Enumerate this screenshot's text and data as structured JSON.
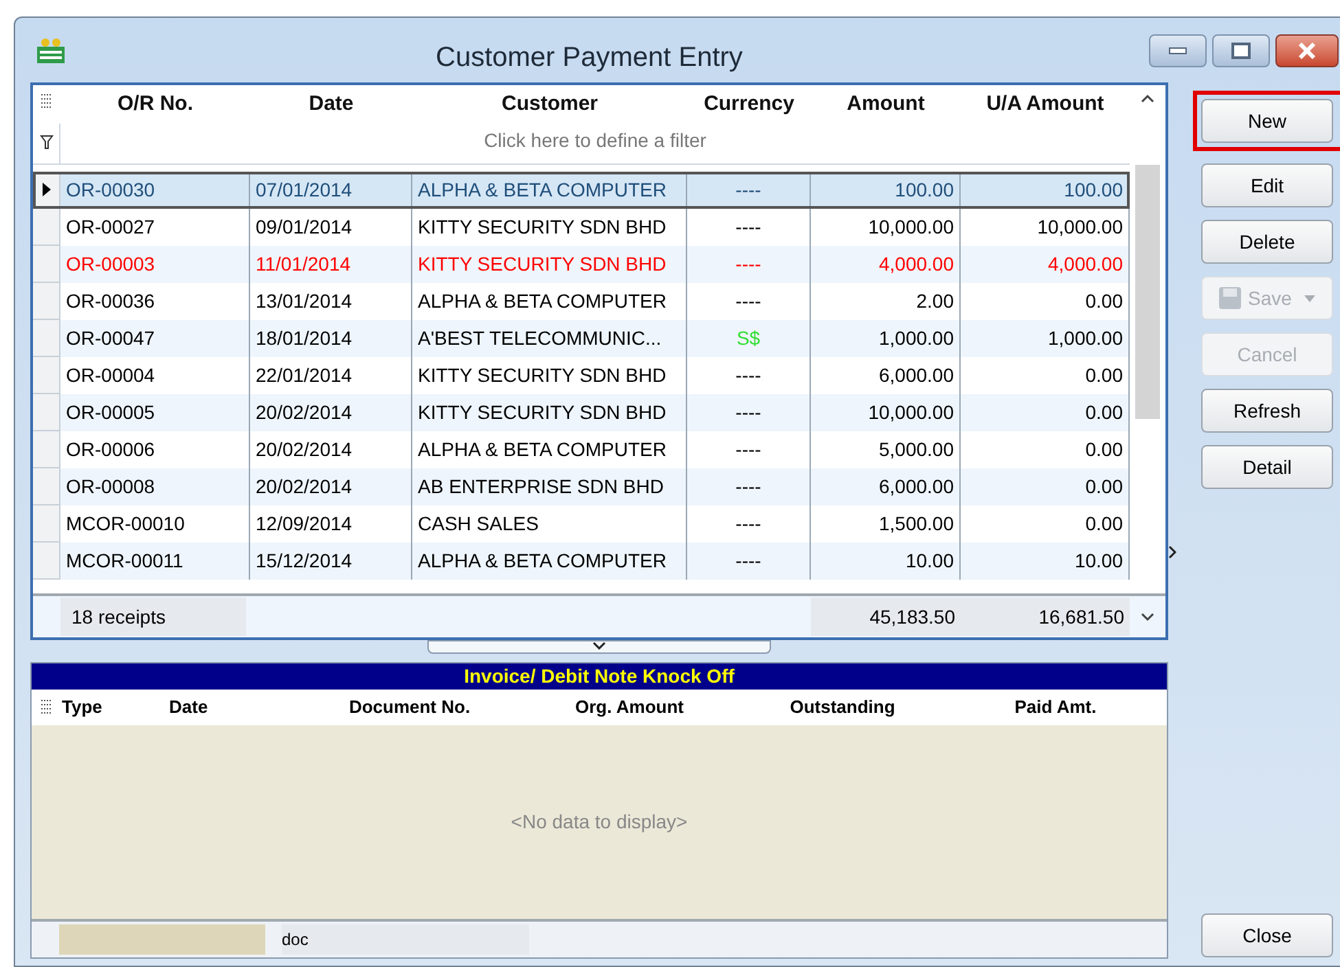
{
  "window": {
    "title": "Customer Payment Entry"
  },
  "receipts": {
    "columns": [
      "O/R No.",
      "Date",
      "Customer",
      "Currency",
      "Amount",
      "U/A Amount"
    ],
    "filter_hint": "Click here to define a filter",
    "rows": [
      {
        "selected": true,
        "color": "#1f4e79",
        "foreign_currency": false,
        "cells": [
          "OR-00030",
          "07/01/2014",
          "ALPHA & BETA COMPUTER",
          "----",
          "100.00",
          "100.00"
        ]
      },
      {
        "selected": false,
        "color": "#000000",
        "foreign_currency": false,
        "cells": [
          "OR-00027",
          "09/01/2014",
          "KITTY SECURITY SDN BHD",
          "----",
          "10,000.00",
          "10,000.00"
        ]
      },
      {
        "selected": false,
        "color": "#ff0000",
        "foreign_currency": false,
        "cells": [
          "OR-00003",
          "11/01/2014",
          "KITTY SECURITY SDN BHD",
          "----",
          "4,000.00",
          "4,000.00"
        ]
      },
      {
        "selected": false,
        "color": "#000000",
        "foreign_currency": false,
        "cells": [
          "OR-00036",
          "13/01/2014",
          "ALPHA & BETA COMPUTER",
          "----",
          "2.00",
          "0.00"
        ]
      },
      {
        "selected": false,
        "color": "#000000",
        "foreign_currency": true,
        "cells": [
          "OR-00047",
          "18/01/2014",
          "A'BEST TELECOMMUNIC...",
          "S$",
          "1,000.00",
          "1,000.00"
        ]
      },
      {
        "selected": false,
        "color": "#000000",
        "foreign_currency": false,
        "cells": [
          "OR-00004",
          "22/01/2014",
          "KITTY SECURITY SDN BHD",
          "----",
          "6,000.00",
          "0.00"
        ]
      },
      {
        "selected": false,
        "color": "#000000",
        "foreign_currency": false,
        "cells": [
          "OR-00005",
          "20/02/2014",
          "KITTY SECURITY SDN BHD",
          "----",
          "10,000.00",
          "0.00"
        ]
      },
      {
        "selected": false,
        "color": "#000000",
        "foreign_currency": false,
        "cells": [
          "OR-00006",
          "20/02/2014",
          "ALPHA & BETA COMPUTER",
          "----",
          "5,000.00",
          "0.00"
        ]
      },
      {
        "selected": false,
        "color": "#000000",
        "foreign_currency": false,
        "cells": [
          "OR-00008",
          "20/02/2014",
          "AB ENTERPRISE SDN BHD",
          "----",
          "6,000.00",
          "0.00"
        ]
      },
      {
        "selected": false,
        "color": "#000000",
        "foreign_currency": false,
        "cells": [
          "MCOR-00010",
          "12/09/2014",
          "CASH SALES",
          "----",
          "1,500.00",
          "0.00"
        ]
      },
      {
        "selected": false,
        "color": "#000000",
        "foreign_currency": false,
        "cells": [
          "MCOR-00011",
          "15/12/2014",
          "ALPHA & BETA COMPUTER",
          "----",
          "10.00",
          "10.00"
        ]
      }
    ],
    "footer": {
      "count": "18 receipts",
      "amount_total": "45,183.50",
      "ua_total": "16,681.50"
    }
  },
  "knock_off": {
    "title": "Invoice/ Debit Note Knock Off",
    "columns": [
      "Type",
      "Date",
      "Document No.",
      "Org. Amount",
      "Outstanding",
      "Paid Amt."
    ],
    "empty_text": "<No data to display>",
    "footer": [
      "doc"
    ]
  },
  "buttons": [
    {
      "label": "New",
      "disabled": false,
      "focused": true,
      "kind": "plain"
    },
    {
      "label": "Edit",
      "disabled": false,
      "focused": false,
      "kind": "plain"
    },
    {
      "label": "Delete",
      "disabled": false,
      "focused": false,
      "kind": "plain"
    },
    {
      "label": "Save",
      "disabled": true,
      "focused": false,
      "kind": "split"
    },
    {
      "label": "Cancel",
      "disabled": true,
      "focused": false,
      "kind": "plain"
    },
    {
      "label": "Refresh",
      "disabled": false,
      "focused": false,
      "kind": "plain"
    },
    {
      "label": "Detail",
      "disabled": false,
      "focused": false,
      "kind": "plain"
    }
  ],
  "close_button": {
    "label": "Close"
  }
}
